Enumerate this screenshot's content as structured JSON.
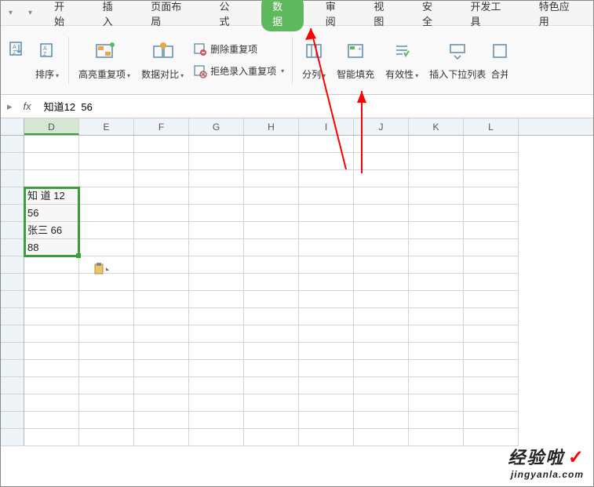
{
  "menu": {
    "items": [
      "开始",
      "插入",
      "页面布局",
      "公式",
      "数据",
      "审阅",
      "视图",
      "安全",
      "开发工具",
      "特色应用"
    ],
    "active_index": 4
  },
  "ribbon": {
    "sort": "排序",
    "highlight": "高亮重复项",
    "compare": "数据对比",
    "remove_dup": "删除重复项",
    "reject_dup": "拒绝录入重复项",
    "split": "分列",
    "smart_fill": "智能填充",
    "validity": "有效性",
    "dropdown": "插入下拉列表",
    "merge": "合并"
  },
  "formula_bar": {
    "fx": "fx",
    "value": "知道12  56"
  },
  "columns": [
    "D",
    "E",
    "F",
    "G",
    "H",
    "I",
    "J",
    "K",
    "L"
  ],
  "selected_col": "D",
  "cells": {
    "r3c0": "知 道 12",
    "r4c0": "56",
    "r5c0": "张三  66",
    "r6c0": "88"
  },
  "watermark": {
    "main": "经验啦",
    "check": "✓",
    "sub": "jingyanla.com"
  }
}
